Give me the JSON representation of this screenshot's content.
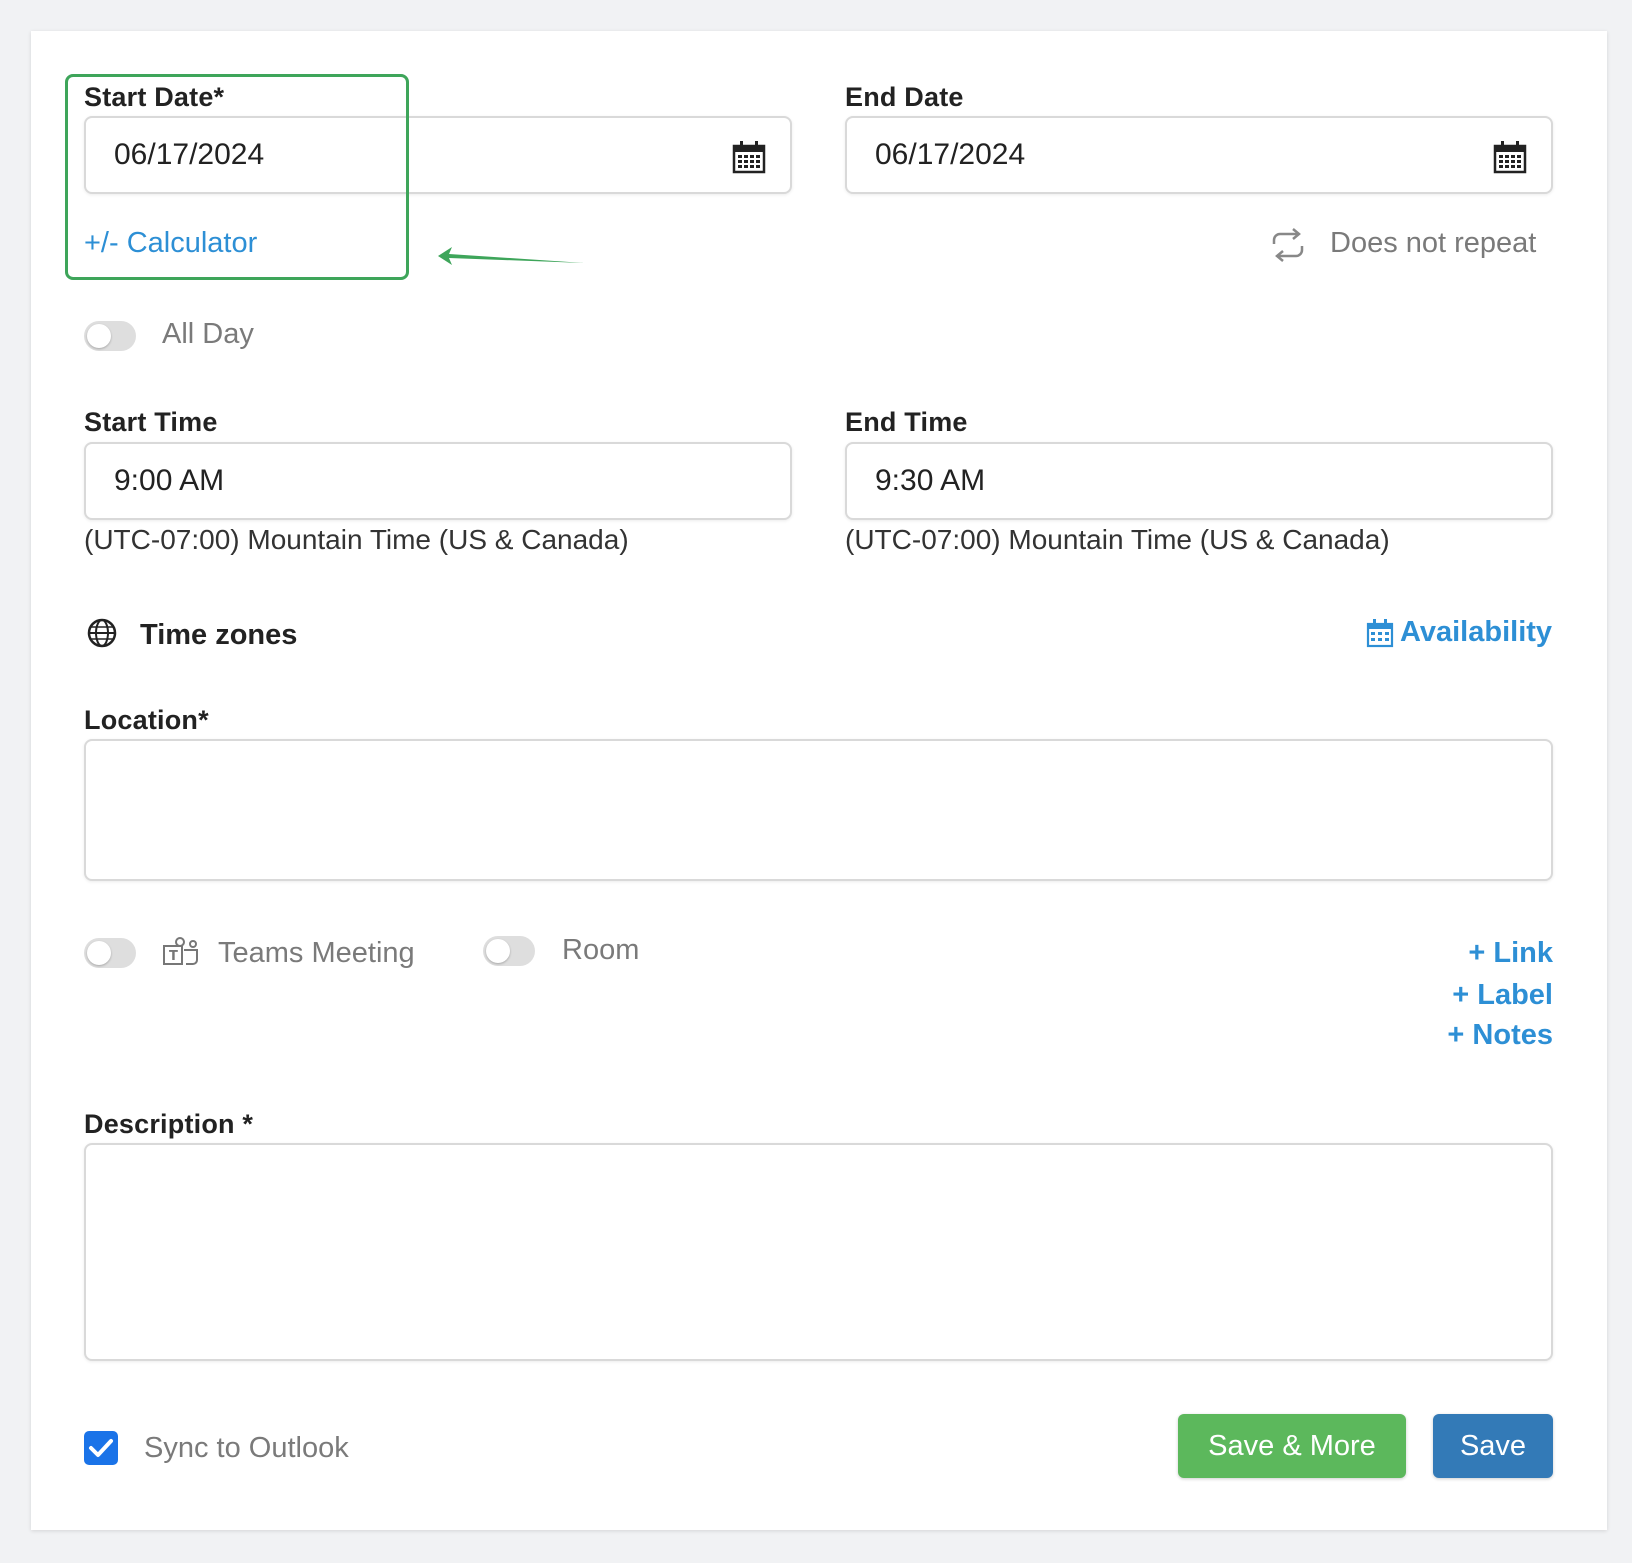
{
  "form": {
    "start_date": {
      "label": "Start Date*",
      "value": "06/17/2024"
    },
    "end_date": {
      "label": "End Date",
      "value": "06/17/2024"
    },
    "calculator_link": "+/- Calculator",
    "repeat_label": "Does not repeat",
    "all_day_label": "All Day",
    "start_time": {
      "label": "Start Time",
      "value": "9:00 AM",
      "timezone": "(UTC-07:00) Mountain Time (US & Canada)"
    },
    "end_time": {
      "label": "End Time",
      "value": "9:30 AM",
      "timezone": "(UTC-07:00) Mountain Time (US & Canada)"
    },
    "time_zones_label": "Time zones",
    "availability_link": "Availability",
    "location": {
      "label": "Location*",
      "value": ""
    },
    "teams_meeting_label": "Teams Meeting",
    "room_label": "Room",
    "add_links": [
      "+ Link",
      "+ Label",
      "+ Notes"
    ],
    "description": {
      "label": "Description *",
      "value": ""
    },
    "sync_label": "Sync to Outlook",
    "sync_checked": true,
    "save_more_button": "Save & More",
    "save_button": "Save"
  },
  "colors": {
    "link_blue": "#2d8fd5",
    "save_more_green": "#5cb85c",
    "save_blue": "#337ab7",
    "highlight_green": "#3ea55a"
  }
}
